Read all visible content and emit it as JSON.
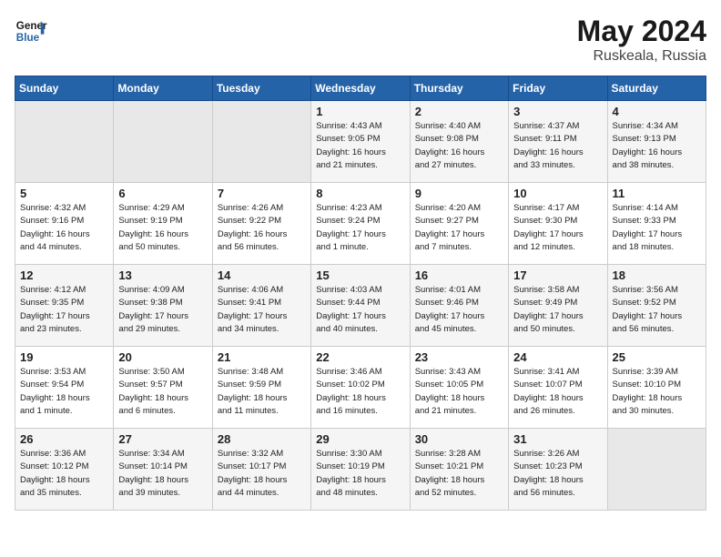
{
  "header": {
    "logo_line1": "General",
    "logo_line2": "Blue",
    "month": "May 2024",
    "location": "Ruskeala, Russia"
  },
  "weekdays": [
    "Sunday",
    "Monday",
    "Tuesday",
    "Wednesday",
    "Thursday",
    "Friday",
    "Saturday"
  ],
  "weeks": [
    [
      {
        "day": "",
        "info": ""
      },
      {
        "day": "",
        "info": ""
      },
      {
        "day": "",
        "info": ""
      },
      {
        "day": "1",
        "info": "Sunrise: 4:43 AM\nSunset: 9:05 PM\nDaylight: 16 hours\nand 21 minutes."
      },
      {
        "day": "2",
        "info": "Sunrise: 4:40 AM\nSunset: 9:08 PM\nDaylight: 16 hours\nand 27 minutes."
      },
      {
        "day": "3",
        "info": "Sunrise: 4:37 AM\nSunset: 9:11 PM\nDaylight: 16 hours\nand 33 minutes."
      },
      {
        "day": "4",
        "info": "Sunrise: 4:34 AM\nSunset: 9:13 PM\nDaylight: 16 hours\nand 38 minutes."
      }
    ],
    [
      {
        "day": "5",
        "info": "Sunrise: 4:32 AM\nSunset: 9:16 PM\nDaylight: 16 hours\nand 44 minutes."
      },
      {
        "day": "6",
        "info": "Sunrise: 4:29 AM\nSunset: 9:19 PM\nDaylight: 16 hours\nand 50 minutes."
      },
      {
        "day": "7",
        "info": "Sunrise: 4:26 AM\nSunset: 9:22 PM\nDaylight: 16 hours\nand 56 minutes."
      },
      {
        "day": "8",
        "info": "Sunrise: 4:23 AM\nSunset: 9:24 PM\nDaylight: 17 hours\nand 1 minute."
      },
      {
        "day": "9",
        "info": "Sunrise: 4:20 AM\nSunset: 9:27 PM\nDaylight: 17 hours\nand 7 minutes."
      },
      {
        "day": "10",
        "info": "Sunrise: 4:17 AM\nSunset: 9:30 PM\nDaylight: 17 hours\nand 12 minutes."
      },
      {
        "day": "11",
        "info": "Sunrise: 4:14 AM\nSunset: 9:33 PM\nDaylight: 17 hours\nand 18 minutes."
      }
    ],
    [
      {
        "day": "12",
        "info": "Sunrise: 4:12 AM\nSunset: 9:35 PM\nDaylight: 17 hours\nand 23 minutes."
      },
      {
        "day": "13",
        "info": "Sunrise: 4:09 AM\nSunset: 9:38 PM\nDaylight: 17 hours\nand 29 minutes."
      },
      {
        "day": "14",
        "info": "Sunrise: 4:06 AM\nSunset: 9:41 PM\nDaylight: 17 hours\nand 34 minutes."
      },
      {
        "day": "15",
        "info": "Sunrise: 4:03 AM\nSunset: 9:44 PM\nDaylight: 17 hours\nand 40 minutes."
      },
      {
        "day": "16",
        "info": "Sunrise: 4:01 AM\nSunset: 9:46 PM\nDaylight: 17 hours\nand 45 minutes."
      },
      {
        "day": "17",
        "info": "Sunrise: 3:58 AM\nSunset: 9:49 PM\nDaylight: 17 hours\nand 50 minutes."
      },
      {
        "day": "18",
        "info": "Sunrise: 3:56 AM\nSunset: 9:52 PM\nDaylight: 17 hours\nand 56 minutes."
      }
    ],
    [
      {
        "day": "19",
        "info": "Sunrise: 3:53 AM\nSunset: 9:54 PM\nDaylight: 18 hours\nand 1 minute."
      },
      {
        "day": "20",
        "info": "Sunrise: 3:50 AM\nSunset: 9:57 PM\nDaylight: 18 hours\nand 6 minutes."
      },
      {
        "day": "21",
        "info": "Sunrise: 3:48 AM\nSunset: 9:59 PM\nDaylight: 18 hours\nand 11 minutes."
      },
      {
        "day": "22",
        "info": "Sunrise: 3:46 AM\nSunset: 10:02 PM\nDaylight: 18 hours\nand 16 minutes."
      },
      {
        "day": "23",
        "info": "Sunrise: 3:43 AM\nSunset: 10:05 PM\nDaylight: 18 hours\nand 21 minutes."
      },
      {
        "day": "24",
        "info": "Sunrise: 3:41 AM\nSunset: 10:07 PM\nDaylight: 18 hours\nand 26 minutes."
      },
      {
        "day": "25",
        "info": "Sunrise: 3:39 AM\nSunset: 10:10 PM\nDaylight: 18 hours\nand 30 minutes."
      }
    ],
    [
      {
        "day": "26",
        "info": "Sunrise: 3:36 AM\nSunset: 10:12 PM\nDaylight: 18 hours\nand 35 minutes."
      },
      {
        "day": "27",
        "info": "Sunrise: 3:34 AM\nSunset: 10:14 PM\nDaylight: 18 hours\nand 39 minutes."
      },
      {
        "day": "28",
        "info": "Sunrise: 3:32 AM\nSunset: 10:17 PM\nDaylight: 18 hours\nand 44 minutes."
      },
      {
        "day": "29",
        "info": "Sunrise: 3:30 AM\nSunset: 10:19 PM\nDaylight: 18 hours\nand 48 minutes."
      },
      {
        "day": "30",
        "info": "Sunrise: 3:28 AM\nSunset: 10:21 PM\nDaylight: 18 hours\nand 52 minutes."
      },
      {
        "day": "31",
        "info": "Sunrise: 3:26 AM\nSunset: 10:23 PM\nDaylight: 18 hours\nand 56 minutes."
      },
      {
        "day": "",
        "info": ""
      }
    ]
  ]
}
